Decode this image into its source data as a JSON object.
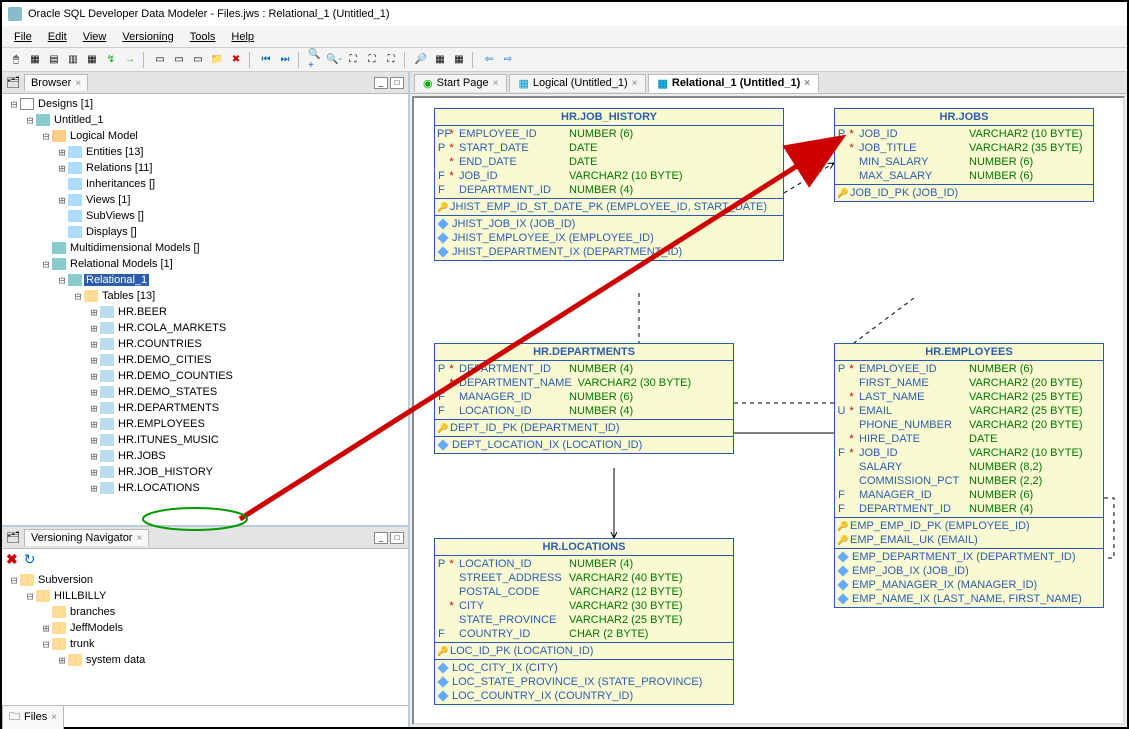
{
  "title": "Oracle SQL Developer Data Modeler - Files.jws : Relational_1 (Untitled_1)",
  "menu": {
    "file": "File",
    "edit": "Edit",
    "view": "View",
    "versioning": "Versioning",
    "tools": "Tools",
    "help": "Help"
  },
  "panels": {
    "browser_tab": "Browser",
    "versioning_tab": "Versioning Navigator",
    "files_tab": "Files"
  },
  "tree": {
    "designs": "Designs [1]",
    "untitled": "Untitled_1",
    "logical": "Logical Model",
    "entities": "Entities [13]",
    "relations": "Relations [11]",
    "inheritances": "Inheritances []",
    "views": "Views [1]",
    "subviews": "SubViews []",
    "displays": "Displays []",
    "multidim": "Multidimensional Models []",
    "relmodels": "Relational Models [1]",
    "relational1": "Relational_1",
    "tables": "Tables [13]",
    "t": [
      "HR.BEER",
      "HR.COLA_MARKETS",
      "HR.COUNTRIES",
      "HR.DEMO_CITIES",
      "HR.DEMO_COUNTIES",
      "HR.DEMO_STATES",
      "HR.DEPARTMENTS",
      "HR.EMPLOYEES",
      "HR.ITUNES_MUSIC",
      "HR.JOBS",
      "HR.JOB_HISTORY",
      "HR.LOCATIONS"
    ]
  },
  "subversion": {
    "root": "Subversion",
    "hillbilly": "HILLBILLY",
    "branches": "branches",
    "jeffmodels": "JeffModels",
    "trunk": "trunk",
    "sysdata": "system data"
  },
  "tabs": {
    "start": "Start Page",
    "logical": "Logical (Untitled_1)",
    "relational": "Relational_1 (Untitled_1)"
  },
  "entities": {
    "jobhistory": {
      "name": "HR.JOB_HISTORY",
      "cols": [
        {
          "f": "PF",
          "s": "*",
          "n": "EMPLOYEE_ID",
          "t": "NUMBER (6)"
        },
        {
          "f": "P",
          "s": "*",
          "n": "START_DATE",
          "t": "DATE"
        },
        {
          "f": "",
          "s": "*",
          "n": "END_DATE",
          "t": "DATE"
        },
        {
          "f": "F",
          "s": "*",
          "n": "JOB_ID",
          "t": "VARCHAR2 (10 BYTE)"
        },
        {
          "f": "F",
          "s": "",
          "n": "DEPARTMENT_ID",
          "t": "NUMBER (4)"
        }
      ],
      "pks": [
        "JHIST_EMP_ID_ST_DATE_PK (EMPLOYEE_ID, START_DATE)"
      ],
      "idx": [
        "JHIST_JOB_IX (JOB_ID)",
        "JHIST_EMPLOYEE_IX (EMPLOYEE_ID)",
        "JHIST_DEPARTMENT_IX (DEPARTMENT_ID)"
      ]
    },
    "jobs": {
      "name": "HR.JOBS",
      "cols": [
        {
          "f": "P",
          "s": "*",
          "n": "JOB_ID",
          "t": "VARCHAR2 (10 BYTE)"
        },
        {
          "f": "",
          "s": "*",
          "n": "JOB_TITLE",
          "t": "VARCHAR2 (35 BYTE)"
        },
        {
          "f": "",
          "s": "",
          "n": "MIN_SALARY",
          "t": "NUMBER (6)"
        },
        {
          "f": "",
          "s": "",
          "n": "MAX_SALARY",
          "t": "NUMBER (6)"
        }
      ],
      "pks": [
        "JOB_ID_PK (JOB_ID)"
      ],
      "idx": []
    },
    "departments": {
      "name": "HR.DEPARTMENTS",
      "cols": [
        {
          "f": "P",
          "s": "*",
          "n": "DEPARTMENT_ID",
          "t": "NUMBER (4)"
        },
        {
          "f": "",
          "s": "*",
          "n": "DEPARTMENT_NAME",
          "t": "VARCHAR2 (30 BYTE)"
        },
        {
          "f": "F",
          "s": "",
          "n": "MANAGER_ID",
          "t": "NUMBER (6)"
        },
        {
          "f": "F",
          "s": "",
          "n": "LOCATION_ID",
          "t": "NUMBER (4)"
        }
      ],
      "pks": [
        "DEPT_ID_PK (DEPARTMENT_ID)"
      ],
      "idx": [
        "DEPT_LOCATION_IX (LOCATION_ID)"
      ]
    },
    "employees": {
      "name": "HR.EMPLOYEES",
      "cols": [
        {
          "f": "P",
          "s": "*",
          "n": "EMPLOYEE_ID",
          "t": "NUMBER (6)"
        },
        {
          "f": "",
          "s": "",
          "n": "FIRST_NAME",
          "t": "VARCHAR2 (20 BYTE)"
        },
        {
          "f": "",
          "s": "*",
          "n": "LAST_NAME",
          "t": "VARCHAR2 (25 BYTE)"
        },
        {
          "f": "U",
          "s": "*",
          "n": "EMAIL",
          "t": "VARCHAR2 (25 BYTE)"
        },
        {
          "f": "",
          "s": "",
          "n": "PHONE_NUMBER",
          "t": "VARCHAR2 (20 BYTE)"
        },
        {
          "f": "",
          "s": "*",
          "n": "HIRE_DATE",
          "t": "DATE"
        },
        {
          "f": "F",
          "s": "*",
          "n": "JOB_ID",
          "t": "VARCHAR2 (10 BYTE)"
        },
        {
          "f": "",
          "s": "",
          "n": "SALARY",
          "t": "NUMBER (8,2)"
        },
        {
          "f": "",
          "s": "",
          "n": "COMMISSION_PCT",
          "t": "NUMBER (2,2)"
        },
        {
          "f": "F",
          "s": "",
          "n": "MANAGER_ID",
          "t": "NUMBER (6)"
        },
        {
          "f": "F",
          "s": "",
          "n": "DEPARTMENT_ID",
          "t": "NUMBER (4)"
        }
      ],
      "pks": [
        "EMP_EMP_ID_PK (EMPLOYEE_ID)",
        "EMP_EMAIL_UK (EMAIL)"
      ],
      "idx": [
        "EMP_DEPARTMENT_IX (DEPARTMENT_ID)",
        "EMP_JOB_IX (JOB_ID)",
        "EMP_MANAGER_IX (MANAGER_ID)",
        "EMP_NAME_IX (LAST_NAME, FIRST_NAME)"
      ]
    },
    "locations": {
      "name": "HR.LOCATIONS",
      "cols": [
        {
          "f": "P",
          "s": "*",
          "n": "LOCATION_ID",
          "t": "NUMBER (4)"
        },
        {
          "f": "",
          "s": "",
          "n": "STREET_ADDRESS",
          "t": "VARCHAR2 (40 BYTE)"
        },
        {
          "f": "",
          "s": "",
          "n": "POSTAL_CODE",
          "t": "VARCHAR2 (12 BYTE)"
        },
        {
          "f": "",
          "s": "*",
          "n": "CITY",
          "t": "VARCHAR2 (30 BYTE)"
        },
        {
          "f": "",
          "s": "",
          "n": "STATE_PROVINCE",
          "t": "VARCHAR2 (25 BYTE)"
        },
        {
          "f": "F",
          "s": "",
          "n": "COUNTRY_ID",
          "t": "CHAR (2 BYTE)"
        }
      ],
      "pks": [
        "LOC_ID_PK (LOCATION_ID)"
      ],
      "idx": [
        "LOC_CITY_IX (CITY)",
        "LOC_STATE_PROVINCE_IX (STATE_PROVINCE)",
        "LOC_COUNTRY_IX (COUNTRY_ID)"
      ]
    }
  }
}
